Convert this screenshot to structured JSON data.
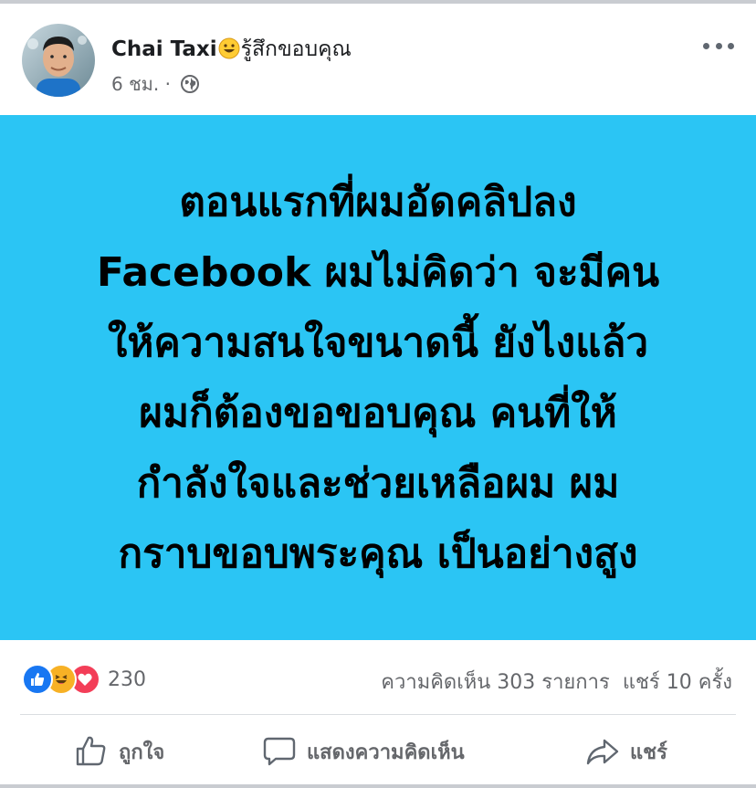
{
  "post": {
    "author": "Chai Taxi",
    "feeling": "รู้สึกขอบคุณ",
    "feeling_icon": "grinning-emoji-icon",
    "time": "6 ชม.",
    "dot": "·",
    "privacy_icon": "globe-icon",
    "text_lines": [
      "ตอนแรกที่ผมอัดคลิปลง",
      "Facebook ผมไม่คิดว่า จะมีคน",
      "ให้ความสนใจขนาดนี้ ยังไงแล้ว",
      "ผมก็ต้องขอขอบคุณ คนที่ให้",
      "กำลังใจและช่วยเหลือผม ผม",
      "กราบขอบพระคุณ เป็นอย่างสูง"
    ],
    "background_color": "#2bc5f4"
  },
  "stats": {
    "reaction_icons": [
      "like-reaction-icon",
      "haha-reaction-icon",
      "love-reaction-icon"
    ],
    "reaction_count": "230",
    "comments": "ความคิดเห็น 303 รายการ",
    "shares": "แชร์ 10 ครั้ง"
  },
  "actions": {
    "like": "ถูกใจ",
    "comment": "แสดงความคิดเห็น",
    "share": "แชร์"
  },
  "colors": {
    "secondary_text": "#65676b",
    "like_blue": "#1877f2",
    "haha_yellow": "#f7b125",
    "love_red": "#f33e58"
  }
}
